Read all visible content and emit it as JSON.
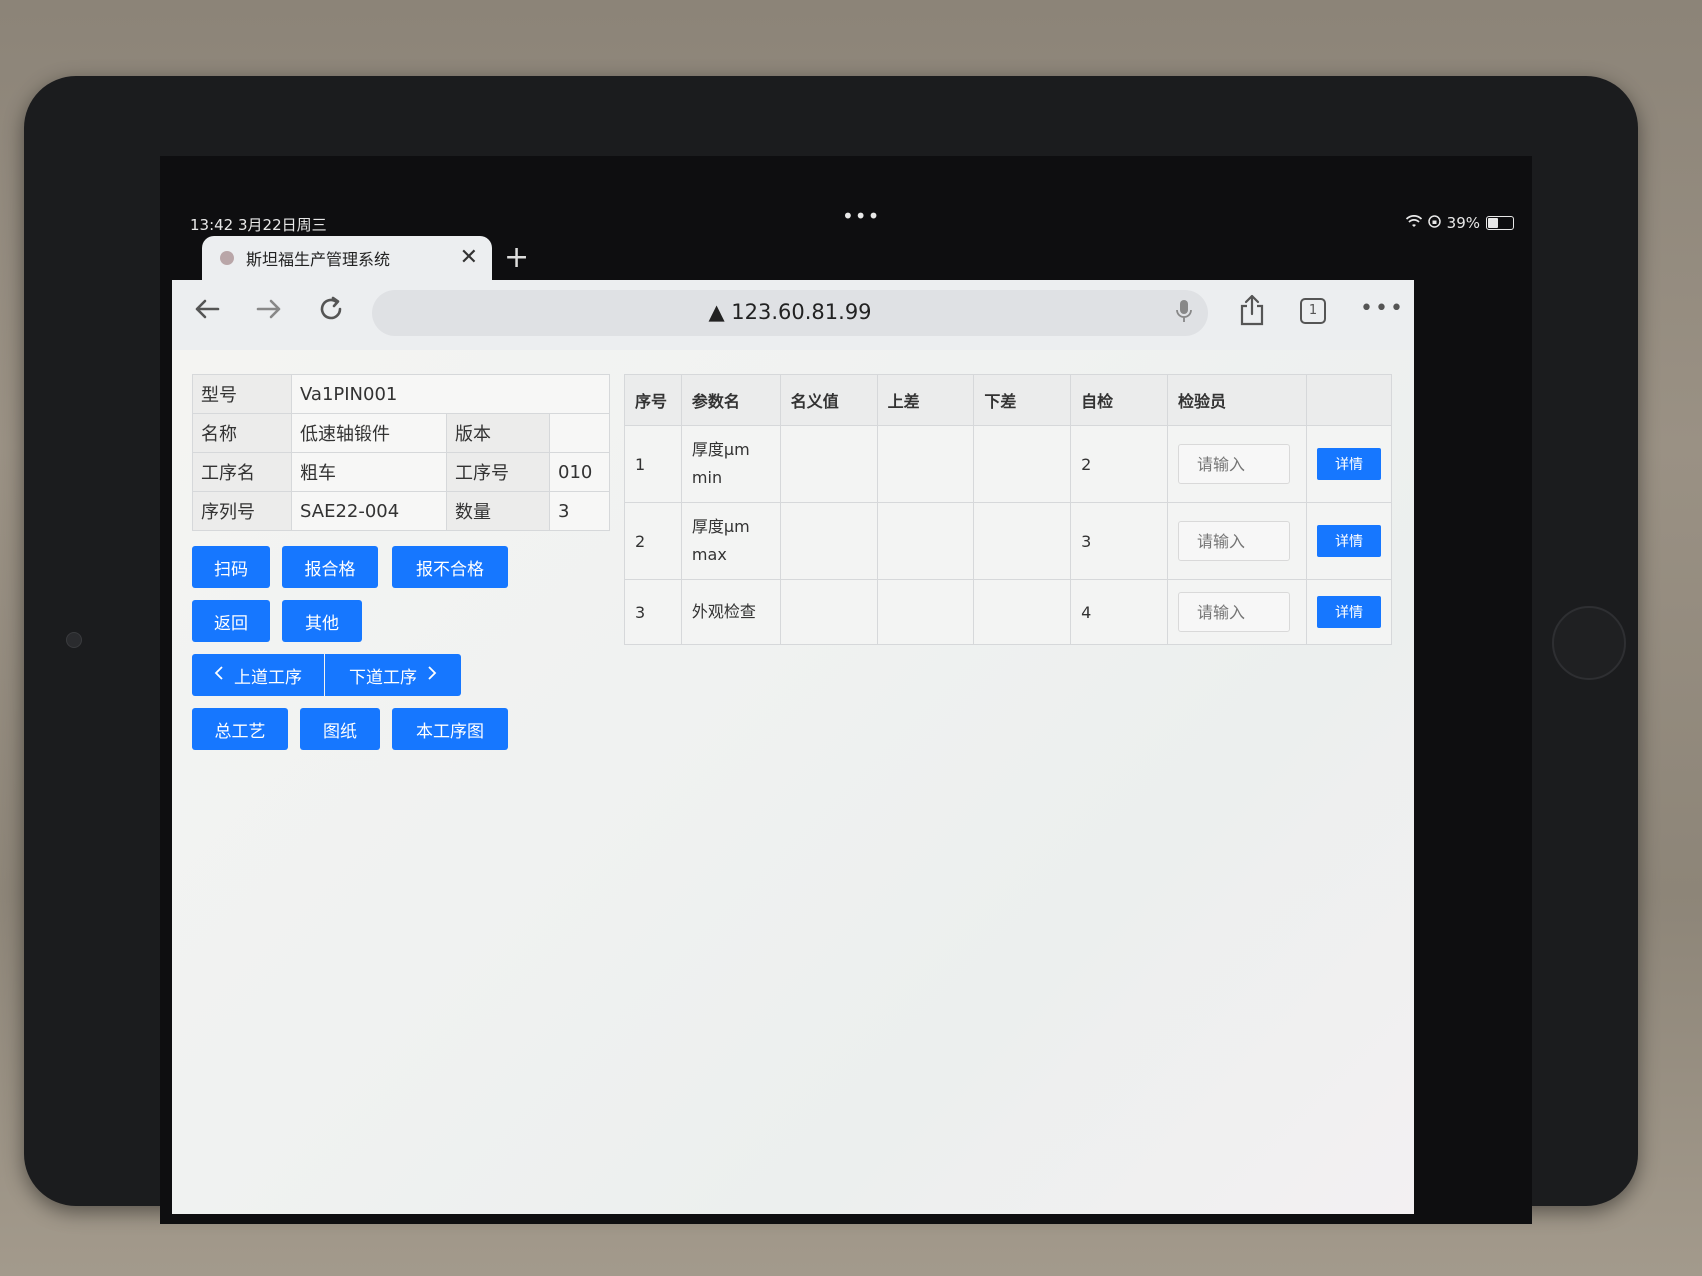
{
  "status_bar": {
    "time": "13:42  3月22日周三",
    "dots": "•••",
    "battery": "39%"
  },
  "browser": {
    "tab_title": "斯坦福生产管理系统",
    "tab_close": "✕",
    "new_tab": "+",
    "url": "▲ 123.60.81.99",
    "tab_count": "1",
    "more": "•••"
  },
  "info": {
    "model_label": "型号",
    "model_value": "Va1PIN001",
    "name_label": "名称",
    "name_value": "低速轴锻件",
    "version_label": "版本",
    "version_value": "",
    "process_name_label": "工序名",
    "process_name_value": "粗车",
    "process_no_label": "工序号",
    "process_no_value": "010",
    "serial_label": "序列号",
    "serial_value": "SAE22-004",
    "qty_label": "数量",
    "qty_value": "3"
  },
  "buttons": {
    "scan": "扫码",
    "pass": "报合格",
    "fail": "报不合格",
    "back": "返回",
    "other": "其他",
    "prev_process": "上道工序",
    "next_process": "下道工序",
    "overall_process": "总工艺",
    "drawing": "图纸",
    "process_drawing": "本工序图"
  },
  "params": {
    "headers": {
      "index": "序号",
      "name": "参数名",
      "nominal": "名义值",
      "upper": "上差",
      "lower": "下差",
      "self_check": "自检",
      "inspector": "检验员",
      "action": ""
    },
    "rows": [
      {
        "index": "1",
        "name_line1": "厚度μm",
        "name_line2": "min",
        "nominal": "",
        "upper": "",
        "lower": "",
        "self_check": "2",
        "placeholder": "请输入",
        "detail": "详情"
      },
      {
        "index": "2",
        "name_line1": "厚度μm",
        "name_line2": "max",
        "nominal": "",
        "upper": "",
        "lower": "",
        "self_check": "3",
        "placeholder": "请输入",
        "detail": "详情"
      },
      {
        "index": "3",
        "name_line1": "外观检查",
        "name_line2": "",
        "nominal": "",
        "upper": "",
        "lower": "",
        "self_check": "4",
        "placeholder": "请输入",
        "detail": "详情"
      }
    ]
  },
  "colors": {
    "primary": "#1677ff"
  }
}
